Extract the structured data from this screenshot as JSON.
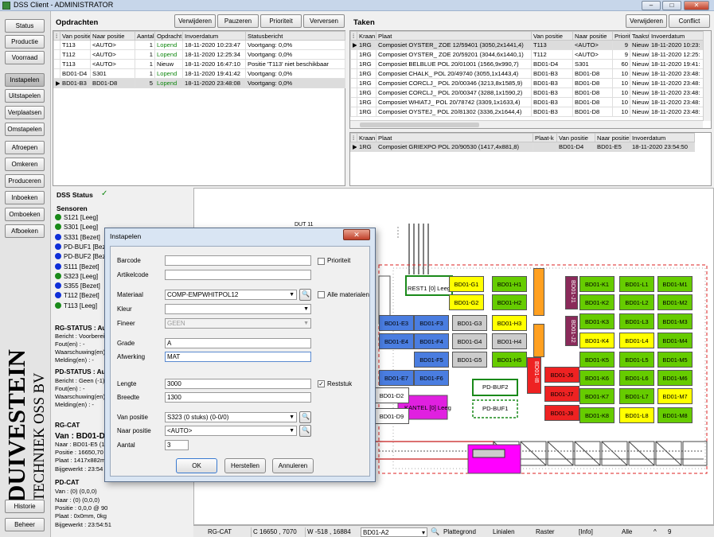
{
  "window": {
    "title": "DSS Client - ADMINISTRATOR"
  },
  "nav": {
    "top": [
      "Status",
      "Productie",
      "Voorraad"
    ],
    "items": [
      "Instapelen",
      "Uitstapelen",
      "Verplaatsen",
      "Omstapelen",
      "Afroepen",
      "Omkeren",
      "Produceren",
      "Inboeken",
      "Omboeken",
      "Afboeken"
    ],
    "bottom": [
      "Historie",
      "Beheer"
    ],
    "brand1": "DUIVESTEIN",
    "brand2": "TECHNIEK OSS BV"
  },
  "opdrachten": {
    "title": "Opdrachten",
    "buttons": [
      "Verwijderen",
      "Pauzeren",
      "Prioriteit",
      "Verversen"
    ],
    "columns": [
      "Van positie",
      "Naar positie",
      "Aantal",
      "Opdracht",
      "Invoerdatum",
      "Statusbericht"
    ],
    "rows": [
      [
        "T113",
        "<AUTO>",
        "1",
        "Lopend",
        "18-11-2020 10:23:47",
        "Voortgang: 0,0%"
      ],
      [
        "T112",
        "<AUTO>",
        "1",
        "Lopend",
        "18-11-2020 12:25:34",
        "Voortgang: 0,0%"
      ],
      [
        "T113",
        "<AUTO>",
        "1",
        "Nieuw",
        "18-11-2020 16:47:10",
        "Positie 'T113' niet beschikbaar"
      ],
      [
        "BD01-D4",
        "S301",
        "1",
        "Lopend",
        "18-11-2020 19:41:42",
        "Voortgang: 0,0%"
      ],
      [
        "BD01-B3",
        "BD01-D8",
        "5",
        "Lopend",
        "18-11-2020 23:48:08",
        "Voortgang: 0,0%"
      ]
    ]
  },
  "taken": {
    "title": "Taken",
    "buttons": [
      "Verwijderen",
      "Conflict"
    ],
    "columns": [
      "Kraan",
      "Plaat",
      "Van positie",
      "Naar positie",
      "Priorit",
      "Taakst",
      "Invoerdatum"
    ],
    "rows": [
      [
        "1RG",
        "Composiet OYSTER_ ZOE 12/59401 (3050,2x1441,4)",
        "T113",
        "<AUTO>",
        "9",
        "Nieuw",
        "18-11-2020 10:23:"
      ],
      [
        "1RG",
        "Composiet OYSTER_ ZOE 20/59201 (3044,6x1440,1)",
        "T112",
        "<AUTO>",
        "9",
        "Nieuw",
        "18-11-2020 12:25:"
      ],
      [
        "1RG",
        "Composiet BELBLUE POL 20/01001 (1566,9x990,7)",
        "BD01-D4",
        "S301",
        "60",
        "Nieuw",
        "18-11-2020 19:41:"
      ],
      [
        "1RG",
        "Composiet CHALK_ POL 20/49740 (3055,1x1443,4)",
        "BD01-B3",
        "BD01-D8",
        "10",
        "Nieuw",
        "18-11-2020 23:48:"
      ],
      [
        "1RG",
        "Composiet CORCLJ_ POL 20/00346 (3213,8x1585,9)",
        "BD01-B3",
        "BD01-D8",
        "10",
        "Nieuw",
        "18-11-2020 23:48:"
      ],
      [
        "1RG",
        "Composiet CORCLJ_ POL 20/00347 (3288,1x1590,2)",
        "BD01-B3",
        "BD01-D8",
        "10",
        "Nieuw",
        "18-11-2020 23:48:"
      ],
      [
        "1RG",
        "Composiet WHIATJ_ POL 20/78742 (3309,1x1633,4)",
        "BD01-B3",
        "BD01-D8",
        "10",
        "Nieuw",
        "18-11-2020 23:48:"
      ],
      [
        "1RG",
        "Composiet OYSTEJ_ POL 20/81302 (3336,2x1644,4)",
        "BD01-B3",
        "BD01-D8",
        "10",
        "Nieuw",
        "18-11-2020 23:48:"
      ]
    ]
  },
  "sub": {
    "columns": [
      "Kraan",
      "Plaat",
      "Plaat-k",
      "Van positie",
      "Naar positie",
      "Invoerdatum"
    ],
    "row": [
      "1RG",
      "Composiet GRIEXPO POL 20/90530 (1417,4x881,8)",
      "",
      "BD01-D4",
      "BD01-E5",
      "18-11-2020 23:54:50"
    ]
  },
  "status": {
    "title": "DSS Status",
    "sensoren": "Sensoren",
    "sensors": [
      {
        "label": "S121 [Leeg]",
        "color": "#1a8a1a"
      },
      {
        "label": "S301 [Leeg]",
        "color": "#1a8a1a"
      },
      {
        "label": "S331 [Bezet]",
        "color": "#1030d8"
      },
      {
        "label": "PD-BUF1 [Bezet",
        "color": "#1030d8"
      },
      {
        "label": "PD-BUF2 [Beze",
        "color": "#1030d8"
      },
      {
        "label": "S111 [Bezet]",
        "color": "#1030d8"
      },
      {
        "label": "S323 [Leeg]",
        "color": "#1a8a1a"
      },
      {
        "label": "S355 [Bezet]",
        "color": "#1030d8"
      },
      {
        "label": "T112 [Bezet]",
        "color": "#1030d8"
      },
      {
        "label": "T113 [Leeg]",
        "color": "#1a8a1a"
      }
    ],
    "lines": [
      {
        "text": "RG-STATUS : Au",
        "bold": true
      },
      {
        "text": "Bericht : Voorberei"
      },
      {
        "text": "Fout(en) : -"
      },
      {
        "text": "Waarschuwing(en)"
      },
      {
        "text": "Melding(en) : -"
      },
      {
        "text": "PD-STATUS : Au",
        "bold": true
      },
      {
        "text": "Bericht : Geen (-1)"
      },
      {
        "text": "Fout(en) : -"
      },
      {
        "text": "Waarschuwing(en)"
      },
      {
        "text": "Melding(en) : -"
      },
      {
        "text": "RG-CAT",
        "bold": true
      },
      {
        "text": "Van : BD01-D",
        "big": true
      },
      {
        "text": "Naar : BD01-E5 (1"
      },
      {
        "text": "Positie : 16650,70"
      },
      {
        "text": "Plaat : 1417x882m"
      },
      {
        "text": "Bijgewerkt : 23:54"
      },
      {
        "text": "PD-CAT",
        "bold": true
      },
      {
        "text": "Van : (0) (0,0,0)"
      },
      {
        "text": "Naar : (0) (0,0,0)"
      },
      {
        "text": "Positie : 0,0,0 @ 90"
      },
      {
        "text": "Plaat : 0x0mm, 0kg"
      },
      {
        "text": "Bijgewerkt : 23:54:51"
      }
    ]
  },
  "map": {
    "label_top": "DUT 11",
    "cells": [
      {
        "l": "BD01-G1",
        "c": "#ffff00"
      },
      {
        "l": "BD01-H1",
        "c": "#66cc00"
      },
      {
        "l": "BD01-K1",
        "c": "#66cc00"
      },
      {
        "l": "BD01-L1",
        "c": "#66cc00"
      },
      {
        "l": "BD01-M1",
        "c": "#66cc00"
      },
      {
        "l": "BD01-G2",
        "c": "#ffff00"
      },
      {
        "l": "BD01-H2",
        "c": "#66cc00"
      },
      {
        "l": "BD01-K2",
        "c": "#66cc00"
      },
      {
        "l": "BD01-L2",
        "c": "#66cc00"
      },
      {
        "l": "BD01-M2",
        "c": "#66cc00"
      },
      {
        "l": "BD01-E3",
        "c": "#4a7de0"
      },
      {
        "l": "BD01-F3",
        "c": "#4a7de0"
      },
      {
        "l": "BD01-G3",
        "c": "#cccccc"
      },
      {
        "l": "BD01-H3",
        "c": "#ffff00"
      },
      {
        "l": "BD01-K3",
        "c": "#66cc00"
      },
      {
        "l": "BD01-L3",
        "c": "#66cc00"
      },
      {
        "l": "BD01-M3",
        "c": "#66cc00"
      },
      {
        "l": "BD01-E4",
        "c": "#4a7de0"
      },
      {
        "l": "BD01-F4",
        "c": "#4a7de0"
      },
      {
        "l": "BD01-G4",
        "c": "#cccccc"
      },
      {
        "l": "BD01-H4",
        "c": "#cccccc"
      },
      {
        "l": "BD01-K4",
        "c": "#ffff00"
      },
      {
        "l": "BD01-L4",
        "c": "#ffff00"
      },
      {
        "l": "BD01-M4",
        "c": "#66cc00"
      },
      {
        "l": "BD01-F5",
        "c": "#4a7de0"
      },
      {
        "l": "BD01-G5",
        "c": "#cccccc"
      },
      {
        "l": "BD01-H5",
        "c": "#66cc00"
      },
      {
        "l": "BD01-K5",
        "c": "#66cc00"
      },
      {
        "l": "BD01-L5",
        "c": "#66cc00"
      },
      {
        "l": "BD01-M5",
        "c": "#66cc00"
      },
      {
        "l": "BD01-E7",
        "c": "#4a7de0"
      },
      {
        "l": "BD01-F6",
        "c": "#4a7de0"
      },
      {
        "l": "BD01-J6",
        "c": "#ee2222"
      },
      {
        "l": "BD01-K6",
        "c": "#66cc00"
      },
      {
        "l": "BD01-L6",
        "c": "#66cc00"
      },
      {
        "l": "BD01-M6",
        "c": "#66cc00"
      },
      {
        "l": "BD01-J7",
        "c": "#ee2222"
      },
      {
        "l": "BD01-K7",
        "c": "#66cc00"
      },
      {
        "l": "BD01-L7",
        "c": "#66cc00"
      },
      {
        "l": "BD01-M7",
        "c": "#ffff00"
      },
      {
        "l": "BD01-J8",
        "c": "#ee2222"
      },
      {
        "l": "BD01-K8",
        "c": "#66cc00"
      },
      {
        "l": "BD01-L8",
        "c": "#ffff00"
      },
      {
        "l": "BD01-M8",
        "c": "#66cc00"
      },
      {
        "l": "BD01-D2",
        "c": "#ffffff"
      },
      {
        "l": "BD01-D9",
        "c": "#ffffff"
      }
    ],
    "rest1": "REST1 [0] Leeg",
    "kantel": "KANTEL [0] Leeg",
    "pdbuf2": "PD-BUF2",
    "pdbuf1": "PD-BUF1",
    "j1": "BD01-J1",
    "j2": "BD01-J2",
    "i8": "BD01-I8"
  },
  "bottombar": {
    "cat": "RG-CAT",
    "c": "C 16650 , 7070",
    "w": "W -518 , 16884",
    "loc": "BD01-A2",
    "items": [
      "Plattegrond",
      "Linialen",
      "Raster",
      "[Info]",
      "Alle"
    ],
    "zoom": "9"
  },
  "dialog": {
    "title": "Instapelen",
    "barcode_label": "Barcode",
    "barcode": "",
    "prioriteit": "Prioriteit",
    "artikel_label": "Artikelcode",
    "artikel": "",
    "materiaal_label": "Materiaal",
    "materiaal": "COMP-EMPWHITPOL12",
    "alle": "Alle materialen",
    "kleur_label": "Kleur",
    "kleur": "",
    "fineer_label": "Fineer",
    "fineer": "GEEN",
    "grade_label": "Grade",
    "grade": "A",
    "afwerking_label": "Afwerking",
    "afwerking": "MAT",
    "lengte_label": "Lengte",
    "lengte": "3000",
    "reststuk": "Reststuk",
    "reststuk_checked": true,
    "breedte_label": "Breedte",
    "breedte": "1300",
    "van_label": "Van positie",
    "van": "S323 (0 stuks) (0-0/0)",
    "naar_label": "Naar positie",
    "naar": "<AUTO>",
    "aantal_label": "Aantal",
    "aantal": "3",
    "ok": "OK",
    "herstellen": "Herstellen",
    "annuleren": "Annuleren"
  }
}
